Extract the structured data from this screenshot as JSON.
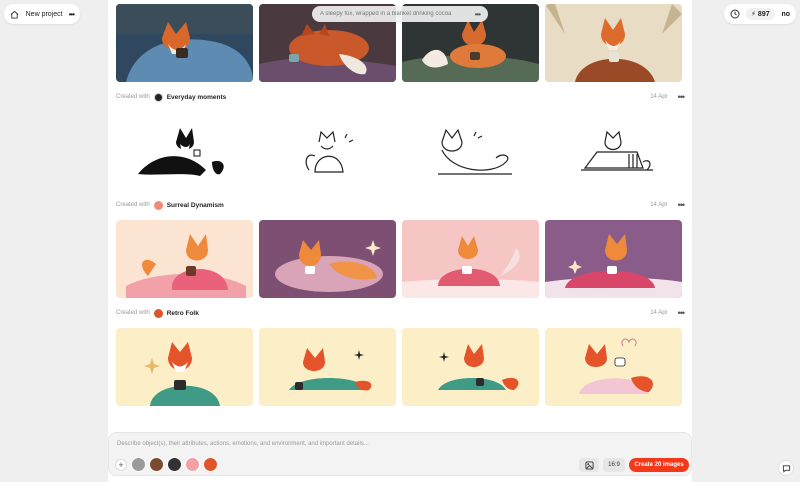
{
  "header": {
    "project_label": "New project",
    "credits": "897",
    "user_initials": "no"
  },
  "prompt_tooltip": "A sleepy fox, wrapped in a blanket drinking cocoa",
  "groups": [
    {
      "created_with": "Created with",
      "style_name": "Everyday moments",
      "date": "14 Apr",
      "images": [
        "line-art-fox-1",
        "line-art-fox-2",
        "line-art-fox-3",
        "line-art-fox-4"
      ]
    },
    {
      "created_with": "Created with",
      "style_name": "Surreal Dynamism",
      "date": "14 Apr",
      "images": [
        "pink-fox-1",
        "pink-fox-2",
        "pink-fox-3",
        "pink-fox-4"
      ]
    },
    {
      "created_with": "Created with",
      "style_name": "Retro Folk",
      "date": "14 Apr",
      "images": [
        "folk-fox-1",
        "folk-fox-2",
        "folk-fox-3",
        "folk-fox-4"
      ]
    }
  ],
  "top_images": [
    "painted-fox-1",
    "painted-fox-2",
    "painted-fox-3",
    "painted-fox-4"
  ],
  "composer": {
    "placeholder": "Describe object(s), their attributes, actions, emotions, and environment, and important details...",
    "ratio": "16:9",
    "create_label": "Create 20 images"
  },
  "colors": {
    "accent": "#f4391b",
    "background": "#efefef",
    "panel": "#ffffff"
  }
}
